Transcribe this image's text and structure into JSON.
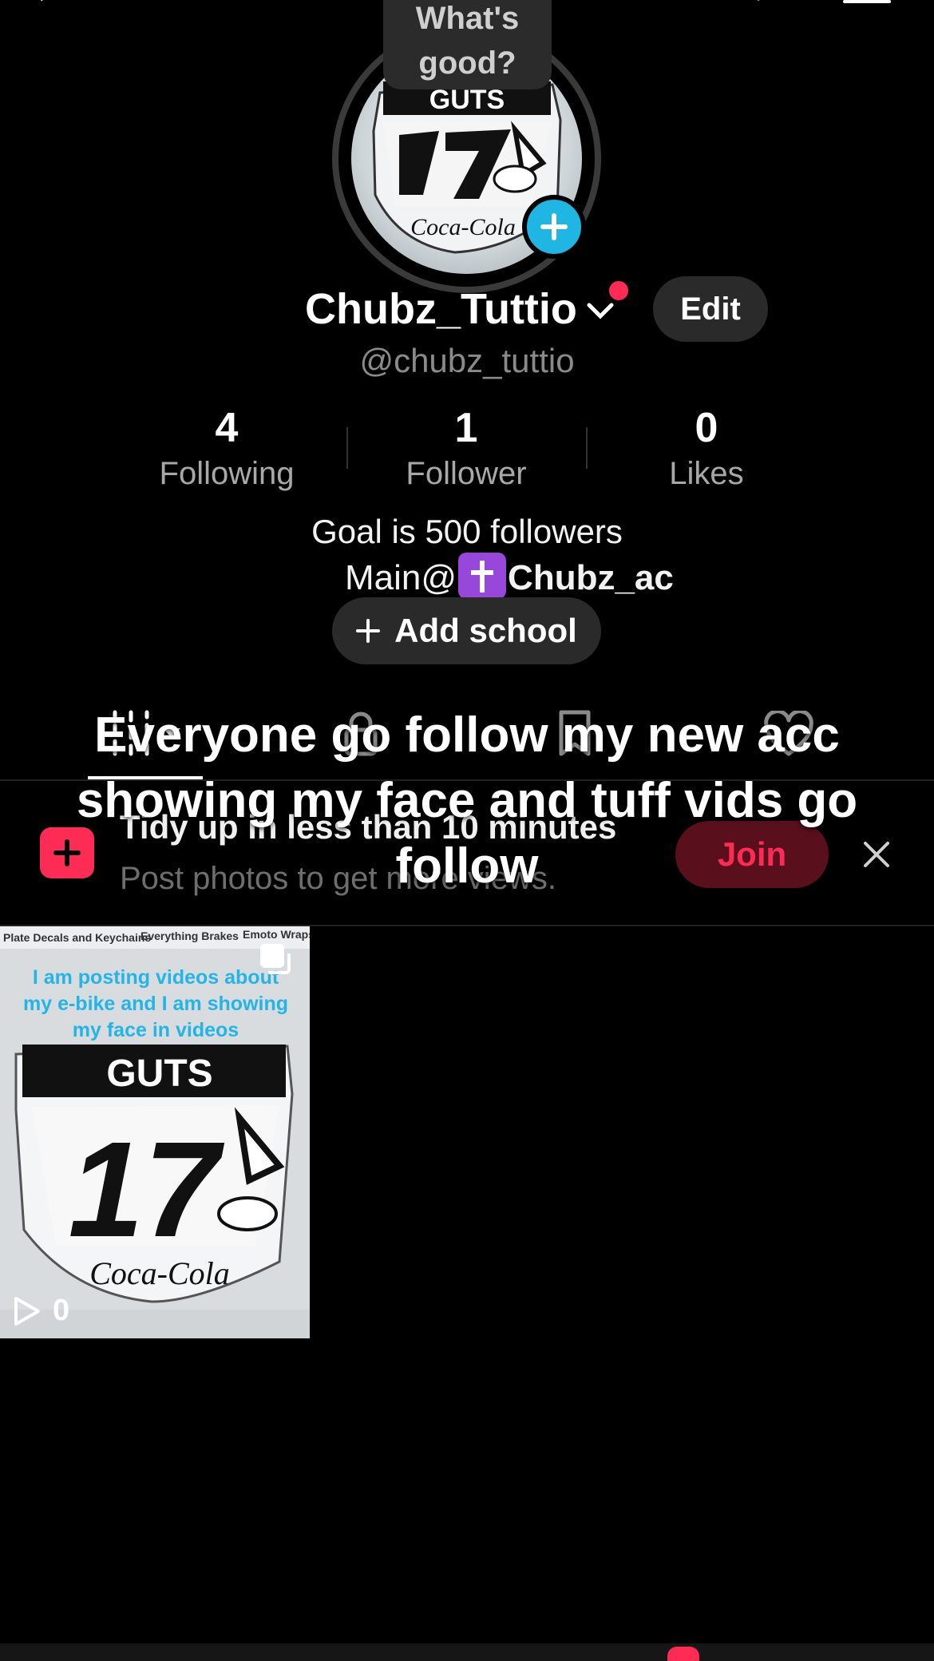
{
  "bubble": {
    "text": "What's good?"
  },
  "profile": {
    "display_name": "Chubz_Tuttio",
    "handle": "@chubz_tuttio",
    "edit_label": "Edit"
  },
  "stats": [
    {
      "value": "4",
      "label": "Following"
    },
    {
      "value": "1",
      "label": "Follower"
    },
    {
      "value": "0",
      "label": "Likes"
    }
  ],
  "bio": {
    "line1": "Goal is 500 followers",
    "line2_prefix": "Main@",
    "line2_handle": "Chubz_ac"
  },
  "add_school_label": "Add school",
  "overlay_caption": "Everyone go follow my new acc showing my face and tuff vids go follow",
  "banner": {
    "title": "Tidy up in less than 10 minutes",
    "subtitle": "Post photos to get more views.",
    "join_label": "Join"
  },
  "video": {
    "caption": "I am posting videos about my e-bike and I am showing my face in videos",
    "top_labels": [
      "Plate Decals and Keychains",
      "Everything Brakes",
      "Emoto Wraps"
    ],
    "views": "0",
    "plate_brand_top": "GUTS",
    "plate_number": "17",
    "plate_brand_bottom": "Coca-Cola"
  },
  "colors": {
    "accent": "#fe2c55",
    "plus_badge": "#1fb6e4",
    "caption_blue": "#22b5e6"
  },
  "icons": {
    "avatar_plus": "plus-icon",
    "name_dropdown": "chevron-down-icon",
    "tab_grid": "grid-icon",
    "tab_locked": "lock-icon",
    "tab_saved": "bookmark-icon",
    "tab_liked": "heart-icon",
    "banner": "camera-plus-icon",
    "close": "close-icon",
    "play": "play-icon",
    "multi": "multi-photo-icon"
  }
}
